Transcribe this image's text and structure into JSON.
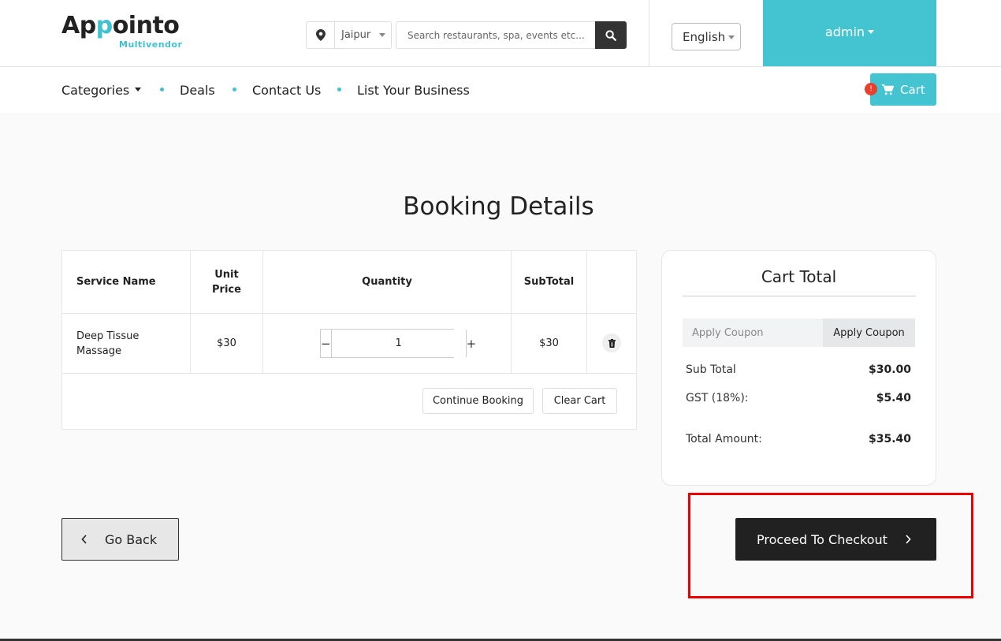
{
  "header": {
    "logo_part1": "Ap",
    "logo_part2": "p",
    "logo_part3": "ointo",
    "logo_sub": "Multivendor",
    "location": "Jaipur",
    "search_placeholder": "Search restaurants, spa, events etc...",
    "language": "English",
    "user": "admin"
  },
  "nav": {
    "categories": "Categories",
    "deals": "Deals",
    "contact": "Contact Us",
    "list_business": "List Your Business",
    "cart_label": "Cart",
    "cart_badge": "!"
  },
  "page": {
    "title": "Booking Details"
  },
  "table": {
    "headers": {
      "service": "Service Name",
      "unit_price_1": "Unit",
      "unit_price_2": "Price",
      "quantity": "Quantity",
      "subtotal": "SubTotal"
    },
    "rows": [
      {
        "service_1": "Deep Tissue",
        "service_2": "Massage",
        "unit_price": "$30",
        "quantity": "1",
        "subtotal": "$30"
      }
    ],
    "continue_label": "Continue Booking",
    "clear_label": "Clear Cart"
  },
  "cart_total": {
    "title": "Cart Total",
    "coupon_placeholder": "Apply Coupon",
    "coupon_button": "Apply Coupon",
    "sub_total_label": "Sub Total",
    "sub_total_value": "$30.00",
    "gst_label": "GST (18%):",
    "gst_value": "$5.40",
    "total_label": "Total Amount:",
    "total_value": "$35.40"
  },
  "actions": {
    "go_back": "Go Back",
    "checkout": "Proceed To Checkout"
  },
  "colors": {
    "accent": "#44c3d1",
    "dark": "#212121",
    "highlight": "#ee0000",
    "badge": "#e8412e"
  }
}
